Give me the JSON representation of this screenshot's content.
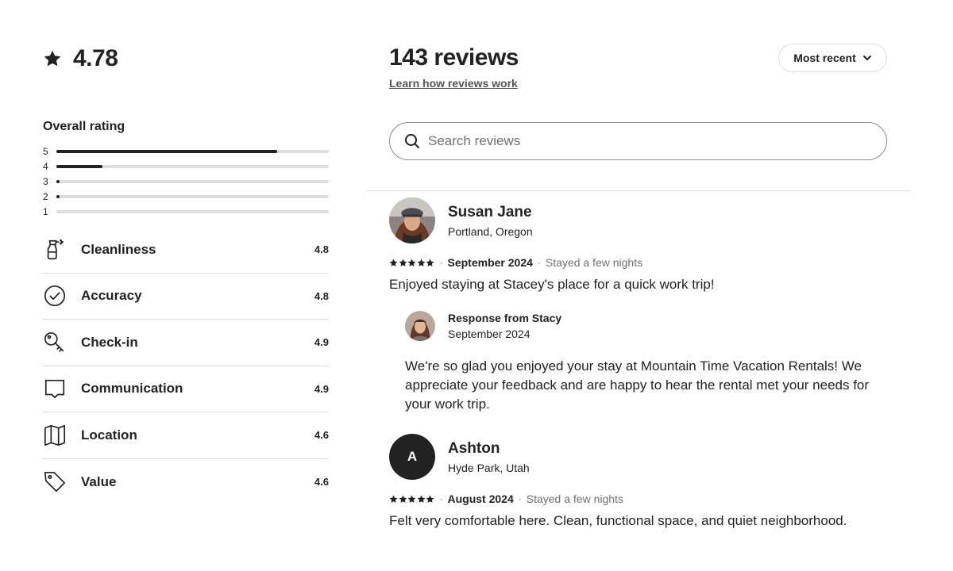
{
  "summary": {
    "overall_score": "4.78",
    "overall_label": "Overall rating",
    "distribution": [
      {
        "stars": "5",
        "fraction": 0.81
      },
      {
        "stars": "4",
        "fraction": 0.17
      },
      {
        "stars": "3",
        "fraction": 0.01
      },
      {
        "stars": "2",
        "fraction": 0.01
      },
      {
        "stars": "1",
        "fraction": 0.0
      }
    ],
    "categories": [
      {
        "icon": "spray-bottle-icon",
        "label": "Cleanliness",
        "value": "4.8"
      },
      {
        "icon": "check-circle-icon",
        "label": "Accuracy",
        "value": "4.8"
      },
      {
        "icon": "key-icon",
        "label": "Check-in",
        "value": "4.9"
      },
      {
        "icon": "chat-bubble-icon",
        "label": "Communication",
        "value": "4.9"
      },
      {
        "icon": "map-icon",
        "label": "Location",
        "value": "4.6"
      },
      {
        "icon": "tag-icon",
        "label": "Value",
        "value": "4.6"
      }
    ]
  },
  "header": {
    "count": "143 reviews",
    "learn_link": "Learn how reviews work",
    "sort_label": "Most recent"
  },
  "search": {
    "placeholder": "Search reviews"
  },
  "reviews": [
    {
      "name": "Susan Jane",
      "location": "Portland, Oregon",
      "rating": 5,
      "date": "September 2024",
      "stay": "Stayed a few nights",
      "text": "Enjoyed staying at Stacey's place for a quick work trip!",
      "response": {
        "title": "Response from Stacy",
        "date": "September 2024",
        "text": "We're so glad you enjoyed your stay at Mountain Time Vacation Rentals! We appreciate your feedback and are happy to hear the rental met your needs for your work trip."
      }
    },
    {
      "name": "Ashton",
      "avatar_letter": "A",
      "location": "Hyde Park, Utah",
      "rating": 5,
      "date": "August 2024",
      "stay": "Stayed a few nights",
      "text": "Felt very comfortable here. Clean, functional space, and quiet neighborhood."
    }
  ],
  "colors": {
    "text": "#222222",
    "muted": "#717171",
    "divider": "#dddddd",
    "bar_fill": "#222222",
    "bar_track": "#dddddd"
  }
}
